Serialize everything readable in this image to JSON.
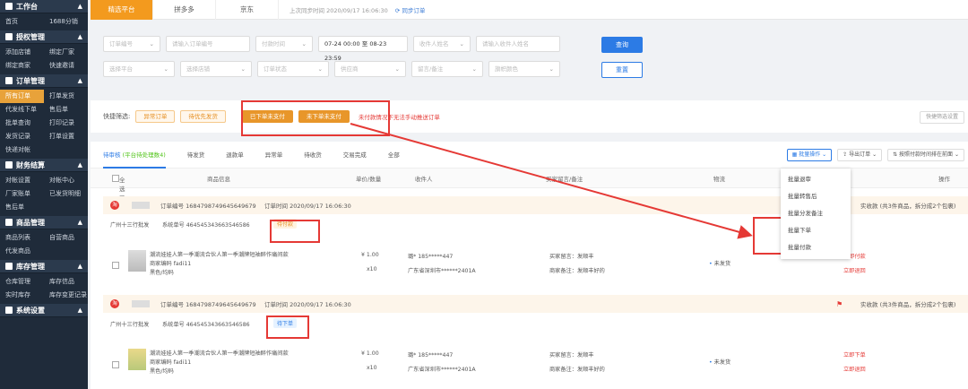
{
  "sidebar": {
    "sections": [
      {
        "title": "工作台",
        "items": [
          "首页",
          "1688分销"
        ]
      },
      {
        "title": "授权管理",
        "items": [
          "添加店铺",
          "绑定厂家",
          "绑定商家",
          "快速邀请"
        ]
      },
      {
        "title": "订单管理",
        "items": [
          "所有订单",
          "打单发货",
          "代发线下单",
          "售后单",
          "批单查询",
          "打印记录",
          "发货记录",
          "打单设置",
          "快递对帐"
        ]
      },
      {
        "title": "财务结算",
        "items": [
          "对帐设置",
          "对帐中心",
          "厂家账单",
          "已发货明细",
          "售后单"
        ]
      },
      {
        "title": "商品管理",
        "items": [
          "商品列表",
          "自营商品",
          "代发商品"
        ]
      },
      {
        "title": "库存管理",
        "items": [
          "仓库管理",
          "库存信品",
          "实时库存",
          "库存变更记录"
        ]
      },
      {
        "title": "系统设置",
        "items": []
      }
    ]
  },
  "tabs": [
    "精选平台",
    "拼多多",
    "京东"
  ],
  "sync": {
    "info": "上次同步时间 2020/09/17 16:06:30",
    "link": "同步订单"
  },
  "filters": {
    "row1": [
      "订单编号",
      "请输入订单编号",
      "付款时间",
      "07-24 00:00 至 08-23 23:59",
      "收件人姓名",
      "请输入收件人姓名"
    ],
    "row2": [
      "选择平台",
      "选择店铺",
      "订单状态",
      "供应商",
      "留言/备注",
      "旗帜颜色"
    ],
    "query": "查询",
    "reset": "重置"
  },
  "quick": {
    "label": "快捷筛选:",
    "btns": [
      "异常订单",
      "待优先发货",
      "已下单未支付",
      "未下单未支付"
    ],
    "note": "未付款情况下无法手动推送订单",
    "right": "快捷筛选设置"
  },
  "status_tabs": [
    {
      "label": "待审核",
      "count": "(平台待处理数4)"
    },
    {
      "label": "待发货"
    },
    {
      "label": "退款单"
    },
    {
      "label": "异常单"
    },
    {
      "label": "待收货"
    },
    {
      "label": "交易完成"
    },
    {
      "label": "全部"
    }
  ],
  "actions": [
    "批量操作",
    "导出订单",
    "按照付款时间排在前面"
  ],
  "table_head": {
    "select": "全选 已选择 0 条",
    "goods": "商品信息",
    "price": "单价/数量",
    "recv": "收件人",
    "note": "买家留言/备注",
    "logistics": "物流",
    "op": "操作"
  },
  "dropdown": [
    "批量退审",
    "批量转售后",
    "批量分发备注",
    "批量下单",
    "批量付款"
  ],
  "orders": [
    {
      "no": "订单编号 1684798749645649679",
      "time": "订单时间 2020/09/17 16:06:30",
      "shop": "广州十三行批发",
      "sys": "系统单号 464545343663546586",
      "tag": "待付款",
      "right": "实收款 (共3件商品，拆分成2个包裹)",
      "title": "潮流娃娃人第一季潮流合伙人第一季潮牌短袖醉作痛间款",
      "code": "商家编码 fadi11",
      "spec": "黑色/均码",
      "price": "¥ 1.00",
      "qty": "x10",
      "phone": "璐* 185*****447",
      "addr": "广东省深圳市******2401A",
      "msg": "买家留言：发顺丰",
      "memo": "商家备注：发顺丰好的",
      "ship": "未发货",
      "op1": "立即付款",
      "op2": "立即退回"
    },
    {
      "no": "订单编号 1684798749645649679",
      "time": "订单时间 2020/09/17 16:06:30",
      "shop": "广州十三行批发",
      "sys": "系统单号 464545343663546586",
      "tag": "待下单",
      "right": "实收款 (共3件商品，拆分成2个包裹)",
      "title": "潮流娃娃人第一季潮流合伙人第一季潮牌短袖醉作痛间款",
      "code": "商家编码 fadi11",
      "spec": "黑色/均码",
      "price": "¥ 1.00",
      "qty": "x10",
      "phone": "璐* 185*****447",
      "addr": "广东省深圳市******2401A",
      "msg": "买家留言：发顺丰",
      "memo": "商家备注：发顺丰好的",
      "ship": "未发货",
      "op1": "立即下单",
      "op2": "立即退回"
    }
  ]
}
